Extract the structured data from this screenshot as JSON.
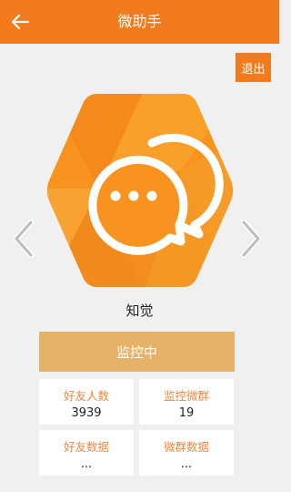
{
  "header": {
    "title": "微助手",
    "back_icon": "back-arrow-icon"
  },
  "logout_label": "退出",
  "mode": {
    "name": "知觉",
    "icon": "chat-bubbles-icon",
    "status_label": "监控中"
  },
  "stats": [
    {
      "label": "好友人数",
      "value": "3939"
    },
    {
      "label": "监控微群",
      "value": "19"
    },
    {
      "label": "好友数据",
      "value": "..."
    },
    {
      "label": "微群数据",
      "value": "..."
    }
  ],
  "colors": {
    "accent": "#f27b1e",
    "status_button": "#e6b267",
    "stat_label": "#f0883c"
  }
}
